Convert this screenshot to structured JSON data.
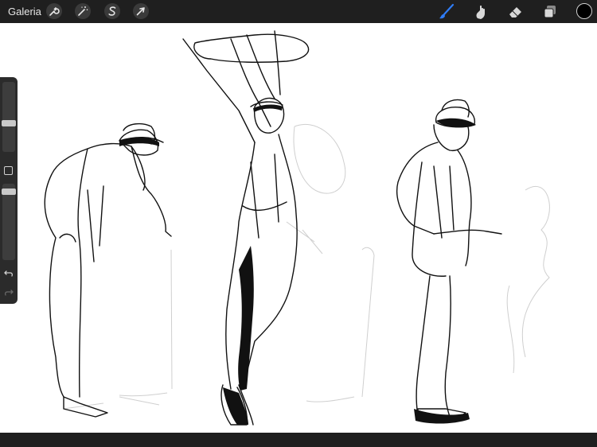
{
  "topbar": {
    "gallery_label": "Galeria",
    "left_tools": [
      {
        "icon": "wrench-icon",
        "name": "actions-button"
      },
      {
        "icon": "magic-wand-icon",
        "name": "adjustments-button"
      },
      {
        "icon": "selection-s-icon",
        "name": "selection-button"
      },
      {
        "icon": "arrow-cursor-icon",
        "name": "transform-button"
      }
    ],
    "right_tools": [
      {
        "icon": "brush-icon",
        "name": "brush-tool",
        "active": true
      },
      {
        "icon": "smudge-icon",
        "name": "smudge-tool",
        "active": false
      },
      {
        "icon": "eraser-icon",
        "name": "eraser-tool",
        "active": false
      },
      {
        "icon": "layers-icon",
        "name": "layers-button",
        "active": false
      }
    ],
    "current_color": "#000000",
    "accent_color": "#2f7cf6"
  },
  "sidebar": {
    "brush_size_level": 0.3,
    "opacity_level": 0.1,
    "icons": [
      "square-modify-icon",
      "undo-icon",
      "redo-icon"
    ]
  }
}
